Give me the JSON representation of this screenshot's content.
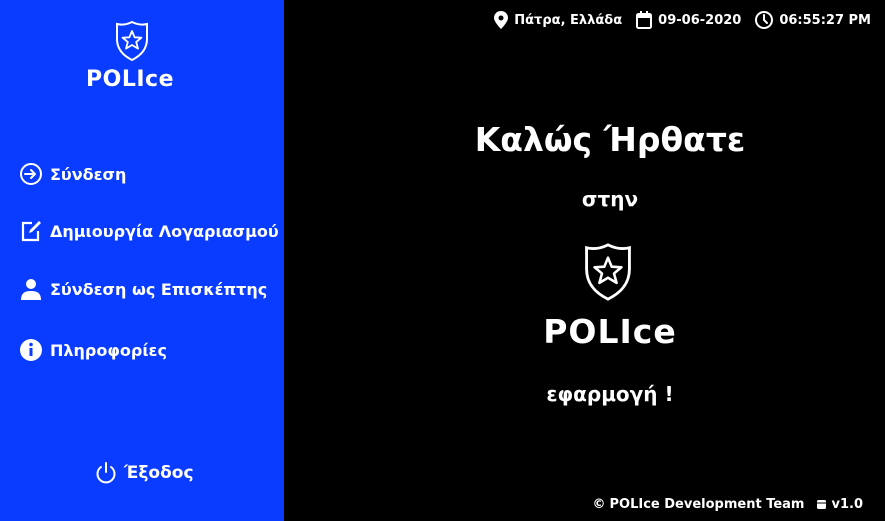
{
  "app": {
    "name": "POLIce"
  },
  "sidebar": {
    "items": [
      {
        "label": "Σύνδεση",
        "icon": "login-arrow-icon"
      },
      {
        "label": "Δημιουργία Λογαριασμού",
        "icon": "edit-note-icon"
      },
      {
        "label": "Σύνδεση ως Επισκέπτης",
        "icon": "person-icon"
      },
      {
        "label": "Πληροφορίες",
        "icon": "info-icon"
      }
    ],
    "exit_label": "Έξοδος"
  },
  "topbar": {
    "location": "Πάτρα, Ελλάδα",
    "date": "09-06-2020",
    "time": "06:55:27 PM"
  },
  "welcome": {
    "title": "Καλώς Ήρθατε",
    "subtitle": "στην",
    "app_name": "POLIce",
    "tagline": "εφαρμογή !"
  },
  "footer": {
    "team": "POLIce Development Team",
    "version": "v1.0"
  },
  "colors": {
    "sidebar": "#0a3cff",
    "background": "#000000",
    "text": "#ffffff"
  }
}
